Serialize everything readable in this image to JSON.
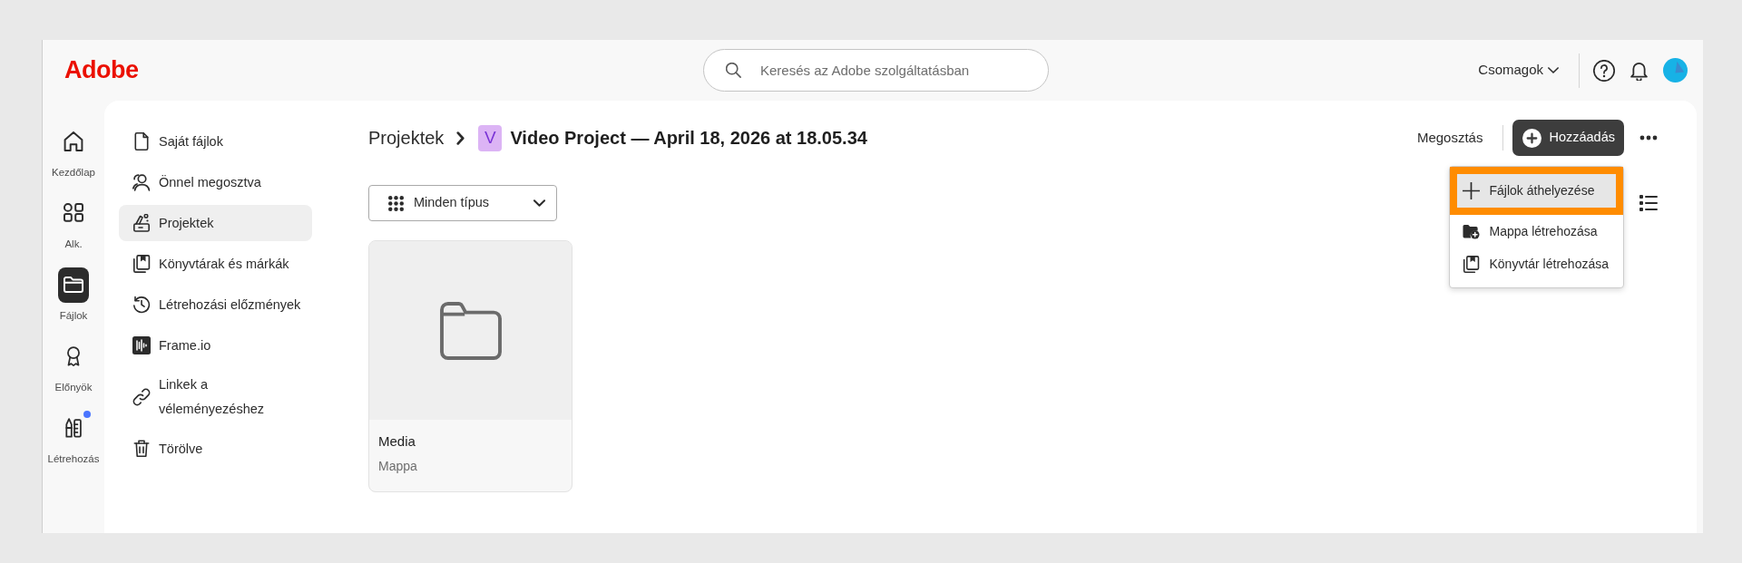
{
  "header": {
    "logo": "Adobe",
    "search": {
      "placeholder": "Keresés az Adobe szolgáltatásban"
    },
    "plans_menu": "Csomagok"
  },
  "rail": [
    {
      "label": "Kezdőlap",
      "selected": false,
      "notification": false
    },
    {
      "label": "Alk.",
      "selected": false,
      "notification": false
    },
    {
      "label": "Fájlok",
      "selected": true,
      "notification": false
    },
    {
      "label": "Előnyök",
      "selected": false,
      "notification": false
    },
    {
      "label": "Létrehozás",
      "selected": false,
      "notification": true
    }
  ],
  "sidebar": [
    {
      "label": "Saját fájlok",
      "selected": false
    },
    {
      "label": "Önnel megosztva",
      "selected": false
    },
    {
      "label": "Projektek",
      "selected": true
    },
    {
      "label": "Könyvtárak és márkák",
      "selected": false
    },
    {
      "label": "Létrehozási előzmények",
      "selected": false
    },
    {
      "label": "Frame.io",
      "selected": false
    },
    {
      "label": "Linkek a véleményezéshez",
      "selected": false
    },
    {
      "label": "Törölve",
      "selected": false
    }
  ],
  "breadcrumb": {
    "parent": "Projektek",
    "badge": "V",
    "title": "Video Project — April 18, 2026 at 18.05.34"
  },
  "actions": {
    "share": "Megosztás",
    "add": "Hozzáadás"
  },
  "add_menu": {
    "open": true,
    "items": [
      {
        "label": "Fájlok áthelyezése",
        "selected": true,
        "outlined": true
      },
      {
        "label": "Mappa létrehozása",
        "selected": false,
        "outlined": false
      },
      {
        "label": "Könyvtár létrehozása",
        "selected": false,
        "outlined": false
      }
    ]
  },
  "filter": {
    "label": "Minden típus"
  },
  "items": [
    {
      "name": "Media",
      "type": "Mappa"
    }
  ]
}
